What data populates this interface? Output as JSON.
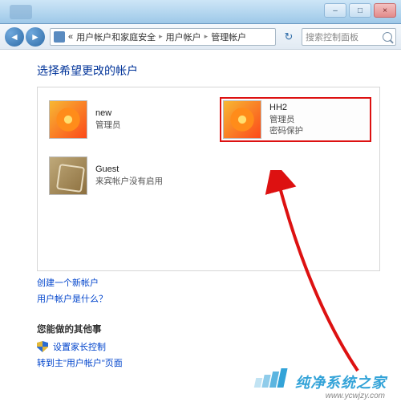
{
  "titlebar": {
    "minimize": "–",
    "maximize": "□",
    "close": "×"
  },
  "toolbar": {
    "back": "◄",
    "forward": "►",
    "crumbs": [
      "用户帐户和家庭安全",
      "用户帐户",
      "管理帐户"
    ],
    "refresh": "↻",
    "search_placeholder": "搜索控制面板"
  },
  "heading": "选择希望更改的帐户",
  "accounts": [
    {
      "name": "new",
      "line1": "管理员",
      "line2": "",
      "pic": "flower",
      "selected": false
    },
    {
      "name": "HH2",
      "line1": "管理员",
      "line2": "密码保护",
      "pic": "flower",
      "selected": true
    },
    {
      "name": "Guest",
      "line1": "来宾帐户没有启用",
      "line2": "",
      "pic": "guest",
      "selected": false
    }
  ],
  "links": {
    "create": "创建一个新帐户",
    "whatis": "用户帐户是什么？"
  },
  "other": {
    "heading": "您能做的其他事",
    "parental": "设置家长控制",
    "goto_main": "转到主\"用户帐户\"页面"
  },
  "footer": {
    "brand": "纯净系统之家",
    "url": "www.ycwjzy.com"
  }
}
